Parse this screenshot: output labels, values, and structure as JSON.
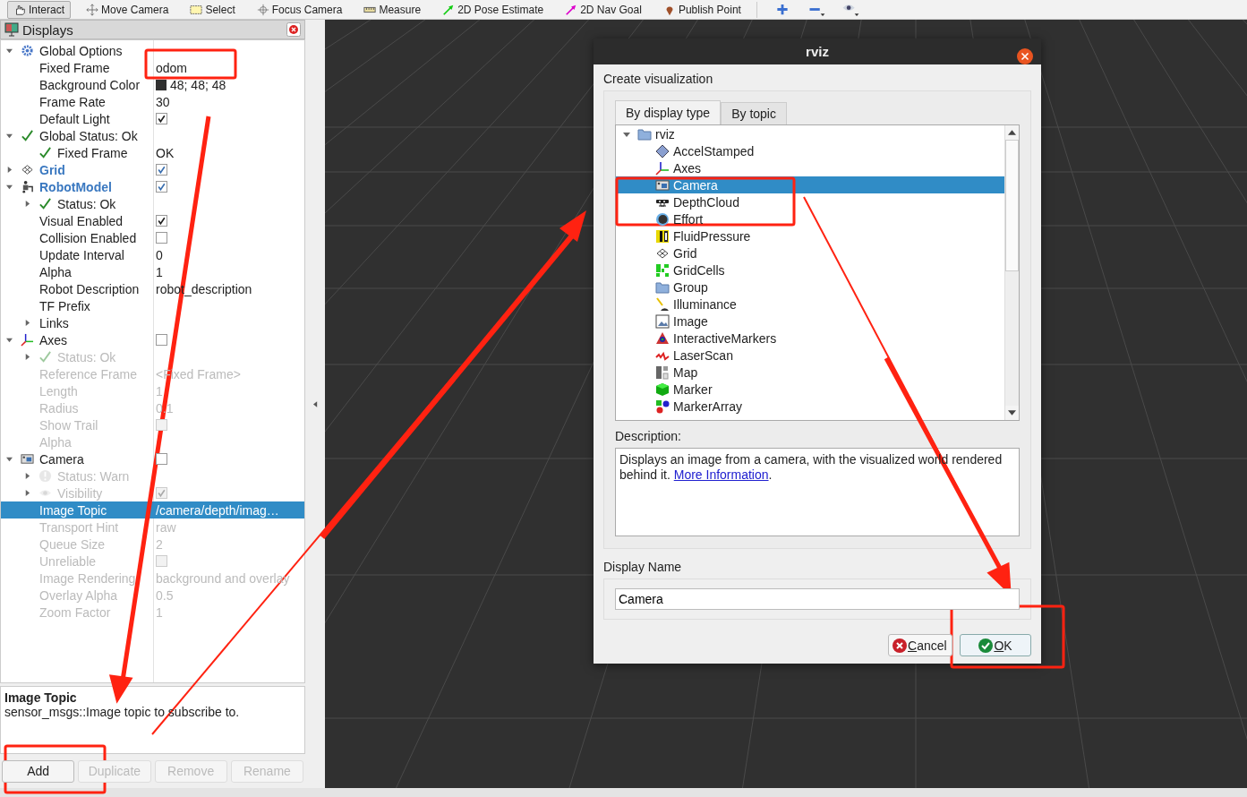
{
  "toolbar": [
    {
      "label": "Interact",
      "kind": "interact",
      "selected": true
    },
    {
      "label": "Move Camera",
      "kind": "move",
      "selected": false
    },
    {
      "label": "Select",
      "kind": "select",
      "selected": false
    },
    {
      "label": "Focus Camera",
      "kind": "focus",
      "selected": false
    },
    {
      "label": "Measure",
      "kind": "measure",
      "selected": false
    },
    {
      "label": "2D Pose Estimate",
      "kind": "pose",
      "selected": false
    },
    {
      "label": "2D Nav Goal",
      "kind": "goal",
      "selected": false
    },
    {
      "label": "Publish Point",
      "kind": "point",
      "selected": false
    }
  ],
  "displays_panel": {
    "title": "Displays",
    "tree": [
      {
        "label": "Global Options",
        "kind": "options",
        "expanded": true,
        "disabled": false,
        "selected": false,
        "children": [
          {
            "label": "Fixed Frame",
            "kind": "property",
            "value": "odom",
            "disabled": false,
            "selected": false
          },
          {
            "label": "Background Color",
            "kind": "property",
            "value": "48; 48; 48",
            "color": "#303030",
            "disabled": false,
            "selected": false
          },
          {
            "label": "Frame Rate",
            "kind": "property",
            "value": "30",
            "disabled": false,
            "selected": false
          },
          {
            "label": "Default Light",
            "kind": "property",
            "checked": true,
            "disabled": false,
            "selected": false
          }
        ]
      },
      {
        "label": "Global Status: Ok",
        "kind": "status-ok",
        "expanded": true,
        "disabled": false,
        "selected": false,
        "children": [
          {
            "label": "Fixed Frame",
            "kind": "status-ok",
            "value": "OK",
            "disabled": false,
            "selected": false
          }
        ]
      },
      {
        "label": "Grid",
        "kind": "grid",
        "expanded": false,
        "checked": true,
        "disabled": false,
        "selected": false
      },
      {
        "label": "RobotModel",
        "kind": "robot",
        "expanded": true,
        "checked": true,
        "disabled": false,
        "selected": false,
        "children": [
          {
            "label": "Status: Ok",
            "kind": "status-ok",
            "expanded": false,
            "disabled": false,
            "selected": false
          },
          {
            "label": "Visual Enabled",
            "kind": "property",
            "checked": true,
            "disabled": false,
            "selected": false
          },
          {
            "label": "Collision Enabled",
            "kind": "property",
            "checked": false,
            "disabled": false,
            "selected": false
          },
          {
            "label": "Update Interval",
            "kind": "property",
            "value": "0",
            "disabled": false,
            "selected": false
          },
          {
            "label": "Alpha",
            "kind": "property",
            "value": "1",
            "disabled": false,
            "selected": false
          },
          {
            "label": "Robot Description",
            "kind": "property",
            "value": "robot_description",
            "disabled": false,
            "selected": false
          },
          {
            "label": "TF Prefix",
            "kind": "property",
            "disabled": false,
            "selected": false
          },
          {
            "label": "Links",
            "kind": "property",
            "expanded": false,
            "disabled": false,
            "selected": false
          }
        ]
      },
      {
        "label": "Axes",
        "kind": "axes",
        "expanded": true,
        "checked": false,
        "disabled": false,
        "selected": false,
        "children": [
          {
            "label": "Status: Ok",
            "kind": "status-ok",
            "expanded": false,
            "disabled": true,
            "selected": false
          },
          {
            "label": "Reference Frame",
            "kind": "property",
            "value": "<Fixed Frame>",
            "disabled": true,
            "selected": false
          },
          {
            "label": "Length",
            "kind": "property",
            "value": "1",
            "disabled": true,
            "selected": false
          },
          {
            "label": "Radius",
            "kind": "property",
            "value": "0.1",
            "disabled": true,
            "selected": false
          },
          {
            "label": "Show Trail",
            "kind": "property",
            "checked": false,
            "disabled": true,
            "selected": false
          },
          {
            "label": "Alpha",
            "kind": "property",
            "disabled": true,
            "selected": false
          }
        ]
      },
      {
        "label": "Camera",
        "kind": "camera",
        "expanded": true,
        "checked": false,
        "disabled": false,
        "selected": false,
        "children": [
          {
            "label": "Status: Warn",
            "kind": "warn",
            "expanded": false,
            "disabled": true,
            "selected": false
          },
          {
            "label": "Visibility",
            "kind": "visibility",
            "expanded": false,
            "checked": true,
            "disabled": true,
            "selected": false
          },
          {
            "label": "Image Topic",
            "kind": "property",
            "value": "/camera/depth/imag…",
            "disabled": false,
            "selected": true
          },
          {
            "label": "Transport Hint",
            "kind": "property",
            "value": "raw",
            "disabled": true,
            "selected": false
          },
          {
            "label": "Queue Size",
            "kind": "property",
            "value": "2",
            "disabled": true,
            "selected": false
          },
          {
            "label": "Unreliable",
            "kind": "property",
            "checked": false,
            "disabled": true,
            "selected": false
          },
          {
            "label": "Image Rendering",
            "kind": "property",
            "value": "background and overlay",
            "disabled": true,
            "selected": false
          },
          {
            "label": "Overlay Alpha",
            "kind": "property",
            "value": "0.5",
            "disabled": true,
            "selected": false
          },
          {
            "label": "Zoom Factor",
            "kind": "property",
            "value": "1",
            "disabled": true,
            "selected": false
          }
        ]
      }
    ]
  },
  "description": {
    "title": "Image Topic",
    "text": "sensor_msgs::Image topic to subscribe to."
  },
  "buttons": [
    {
      "label": "Add",
      "disabled": false
    },
    {
      "label": "Duplicate",
      "disabled": true
    },
    {
      "label": "Remove",
      "disabled": true
    },
    {
      "label": "Rename",
      "disabled": true
    }
  ],
  "dialog": {
    "title": "rviz",
    "heading": "Create visualization",
    "tabs": [
      {
        "label": "By display type",
        "selected": true
      },
      {
        "label": "By topic",
        "selected": false
      }
    ],
    "tree": {
      "label": "rviz",
      "expanded": true,
      "children": [
        {
          "label": "AccelStamped",
          "kind": "accel",
          "selected": false
        },
        {
          "label": "Axes",
          "kind": "axes",
          "selected": false
        },
        {
          "label": "Camera",
          "kind": "camera",
          "selected": true
        },
        {
          "label": "DepthCloud",
          "kind": "depthcloud",
          "selected": false
        },
        {
          "label": "Effort",
          "kind": "effort",
          "selected": false
        },
        {
          "label": "FluidPressure",
          "kind": "fluid",
          "selected": false
        },
        {
          "label": "Grid",
          "kind": "grid",
          "selected": false
        },
        {
          "label": "GridCells",
          "kind": "gridcells",
          "selected": false
        },
        {
          "label": "Group",
          "kind": "group",
          "selected": false
        },
        {
          "label": "Illuminance",
          "kind": "illuminance",
          "selected": false
        },
        {
          "label": "Image",
          "kind": "image",
          "selected": false
        },
        {
          "label": "InteractiveMarkers",
          "kind": "interactive",
          "selected": false
        },
        {
          "label": "LaserScan",
          "kind": "laserscan",
          "selected": false
        },
        {
          "label": "Map",
          "kind": "map",
          "selected": false
        },
        {
          "label": "Marker",
          "kind": "marker",
          "selected": false
        },
        {
          "label": "MarkerArray",
          "kind": "markerarray",
          "selected": false
        }
      ]
    },
    "description_label": "Description:",
    "description": {
      "text": "Displays an image from a camera, with the visualized world rendered behind it.",
      "link": "More Information",
      "after": "."
    },
    "name_label": "Display Name",
    "name_value": "Camera",
    "buttons": [
      {
        "label": "Cancel",
        "kind": "cancel"
      },
      {
        "label": "OK",
        "kind": "ok"
      }
    ]
  }
}
